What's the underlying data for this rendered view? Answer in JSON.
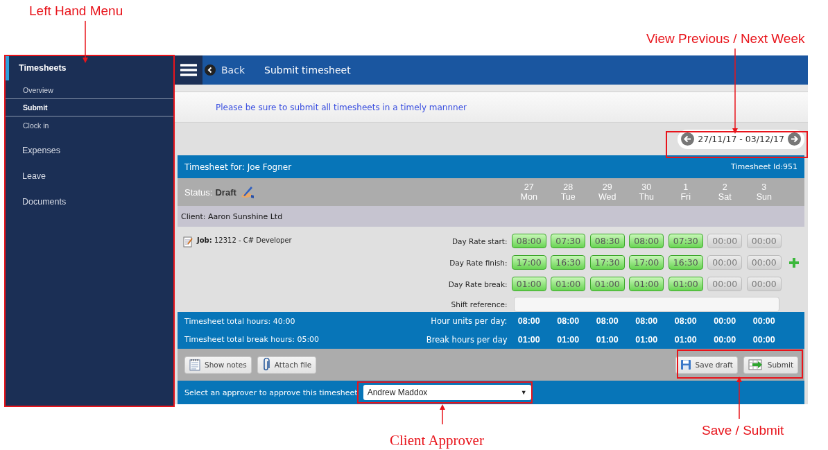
{
  "annotations": [
    {
      "text": "Left Hand Menu"
    },
    {
      "text": "View Previous / Next Week"
    },
    {
      "text": "Client Approver"
    },
    {
      "text": "Save / Submit"
    }
  ],
  "sidebar": {
    "items": [
      {
        "label": "Timesheets",
        "selected": true,
        "children": [
          {
            "label": "Overview",
            "selected": false
          },
          {
            "label": "Submit",
            "selected": true
          },
          {
            "label": "Clock in",
            "selected": false
          }
        ]
      },
      {
        "label": "Expenses",
        "selected": false
      },
      {
        "label": "Leave",
        "selected": false
      },
      {
        "label": "Documents",
        "selected": false
      }
    ]
  },
  "header": {
    "back": "Back",
    "title": "Submit timesheet"
  },
  "notice": "Please be sure to submit all timesheets in a timely mannner",
  "week": {
    "range": "27/11/17 - 03/12/17"
  },
  "timesheet": {
    "title": "Timesheet for: Joe Fogner",
    "id": "Timesheet Id:951",
    "status_label": "Status:",
    "status": "Draft",
    "days": [
      {
        "date": "27",
        "day": "Mon"
      },
      {
        "date": "28",
        "day": "Tue"
      },
      {
        "date": "29",
        "day": "Wed"
      },
      {
        "date": "30",
        "day": "Thu"
      },
      {
        "date": "1",
        "day": "Fri"
      },
      {
        "date": "2",
        "day": "Sat"
      },
      {
        "date": "3",
        "day": "Sun"
      }
    ],
    "client": "Client: Aaron Sunshine Ltd",
    "job_label": "Job:",
    "job": "12312 - C# Developer",
    "rows": [
      {
        "label": "Day Rate start:",
        "times": [
          {
            "value": "08:00",
            "entered": true
          },
          {
            "value": "07:30",
            "entered": true
          },
          {
            "value": "08:30",
            "entered": true
          },
          {
            "value": "08:00",
            "entered": true
          },
          {
            "value": "07:30",
            "entered": true
          },
          {
            "value": "00:00",
            "entered": false
          },
          {
            "value": "00:00",
            "entered": false
          }
        ]
      },
      {
        "label": "Day Rate finish:",
        "times": [
          {
            "value": "17:00",
            "entered": true
          },
          {
            "value": "16:30",
            "entered": true
          },
          {
            "value": "17:30",
            "entered": true
          },
          {
            "value": "17:00",
            "entered": true
          },
          {
            "value": "16:30",
            "entered": true
          },
          {
            "value": "00:00",
            "entered": false
          },
          {
            "value": "00:00",
            "entered": false
          }
        ],
        "add_button": true
      },
      {
        "label": "Day Rate break:",
        "times": [
          {
            "value": "01:00",
            "entered": true
          },
          {
            "value": "01:00",
            "entered": true
          },
          {
            "value": "01:00",
            "entered": true
          },
          {
            "value": "01:00",
            "entered": true
          },
          {
            "value": "01:00",
            "entered": true
          },
          {
            "value": "00:00",
            "entered": false
          },
          {
            "value": "00:00",
            "entered": false
          }
        ]
      }
    ],
    "shift_label": "Shift reference:",
    "totals": [
      {
        "summary": "Timesheet total hours: 40:00",
        "label": "Hour units per day:",
        "values": [
          "08:00",
          "08:00",
          "08:00",
          "08:00",
          "08:00",
          "00:00",
          "00:00"
        ]
      },
      {
        "summary": "Timesheet total break hours: 05:00",
        "label": "Break hours per day",
        "values": [
          "01:00",
          "01:00",
          "01:00",
          "01:00",
          "01:00",
          "00:00",
          "00:00"
        ]
      }
    ],
    "buttons": [
      {
        "label": "Show notes",
        "kind": "notes"
      },
      {
        "label": "Attach file",
        "kind": "attach"
      },
      {
        "label": "Save draft",
        "kind": "save"
      },
      {
        "label": "Submit",
        "kind": "submit"
      }
    ],
    "approver": {
      "label": "Select an approver to approve this timesheet",
      "value": "Andrew Maddox",
      "caret": "▼"
    }
  }
}
